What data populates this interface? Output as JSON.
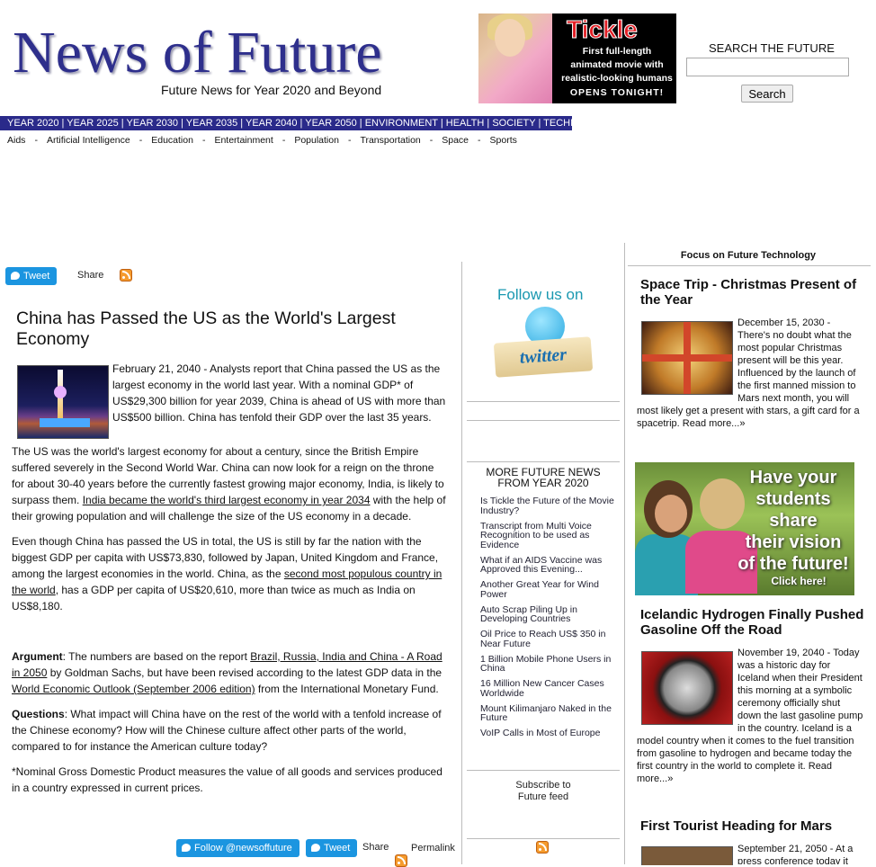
{
  "site": {
    "logo": "News of Future",
    "tagline": "Future News for Year 2020 and Beyond"
  },
  "ad": {
    "title": "Tickle",
    "line1": "First full-length",
    "line2": "animated movie with",
    "line3": "realistic-looking humans",
    "cta": "OPENS TONIGHT!"
  },
  "search": {
    "label": "SEARCH THE FUTURE",
    "value": "",
    "button": "Search"
  },
  "nav": {
    "years": "YEAR 2020 | YEAR 2025  | YEAR 2030 | YEAR 2035  | YEAR 2040 | YEAR 2050  | ENVIRONMENT | HEALTH  | SOCIETY | TECHNOLOGY"
  },
  "subnav": [
    "Aids",
    "Artificial Intelligence",
    "Education",
    "Entertainment",
    "Population",
    "Transportation",
    "Space",
    "Sports"
  ],
  "subnav_sep": "-",
  "social_top": {
    "tweet": "Tweet",
    "share": "Share"
  },
  "article": {
    "headline": "China has Passed the US as the World's Largest Economy",
    "p1": "February 21, 2040 - Analysts report that China passed the US as the largest economy in the world last year. With a nominal GDP* of US$29,300 billion for year 2039, China is ahead of US with more than US$500 billion. China has tenfold their GDP over the last 35 years.",
    "p2a": "The US was the world's largest economy for about a century, since the British Empire suffered severely in the Second World War. China can now look for a reign on the throne for about 30-40 years before the currently fastest growing major economy, India, is likely to surpass them. ",
    "p2link": "India became the world's third largest economy in year 2034",
    "p2b": " with the help of their growing population and will challenge the size of the US economy in a decade.",
    "p3a": "Even though China has passed the US in total, the US is still by far the nation with the biggest GDP per capita with US$73,830, followed by Japan, United Kingdom and France, among the largest economies in the world. China, as the ",
    "p3link": "second most populous country in the world",
    "p3b": ", has a GDP per capita of US$20,610, more than twice as much as India on US$8,180.",
    "arg_label": "Argument",
    "arg_a": ": The numbers are based on the report ",
    "arg_link1": "Brazil, Russia, India and China - A Road in 2050",
    "arg_b": " by Goldman Sachs, but have been revised according to the latest GDP data in the ",
    "arg_link2": "World Economic Outlook (September 2006 edition)",
    "arg_c": " from the International Monetary Fund.",
    "q_label": "Questions",
    "q_text": ": What impact will China have on the rest of the world with a tenfold increase of the Chinese economy? How will the Chinese culture affect other parts of the world, compared to for instance the American culture today?",
    "footnote": "*Nominal Gross Domestic Product measures the value of all goods and services produced in a country expressed in current prices."
  },
  "social_bottom": {
    "follow": "Follow @newsoffuture",
    "tweet": "Tweet",
    "share": "Share",
    "permalink": "Permalink"
  },
  "middle": {
    "follow_us": "Follow us on",
    "twitter_sign": "twitter",
    "more_title": "MORE FUTURE NEWS FROM YEAR 2020",
    "more_items": [
      "Is Tickle the Future of the Movie Industry?",
      "Transcript from Multi Voice Recognition to be used as Evidence",
      "What if an AIDS Vaccine was Approved this Evening...",
      "Another Great Year for Wind Power",
      "Auto Scrap Piling Up in Developing Countries",
      "Oil Price to Reach US$ 350 in Near Future",
      "1 Billion Mobile Phone Users in China",
      "16 Million New Cancer Cases Worldwide",
      "Mount Kilimanjaro Naked in the Future",
      "VoIP Calls in Most of Europe"
    ],
    "subscribe_line1": "Subscribe to",
    "subscribe_line2": "Future feed"
  },
  "right": {
    "focus": "Focus on Future Technology",
    "s1_title": "Space Trip - Christmas Present of the Year",
    "s1_text": "December 15, 2030 - There's no doubt what the most popular Christmas present will be this year. Influenced by the launch of the first manned mission to Mars next month, you will most likely get a present with stars, a gift card for a spacetrip.",
    "read_more": "Read more...»",
    "banner_line1": "Have your",
    "banner_line2": "students",
    "banner_line3": "share",
    "banner_line4": "their vision",
    "banner_line5": "of the future!",
    "banner_click": "Click here!",
    "s2_title": "Icelandic Hydrogen Finally Pushed Gasoline Off the Road",
    "s2_text": "November 19, 2040 - Today was a historic day for Iceland when their President this morning at a symbolic ceremony officially shut down the last gasoline pump in the country. Iceland is a model country when it comes to the fuel transition from gasoline to hydrogen and became today the first country in the world to complete it.",
    "s3_title": "First Tourist Heading for Mars",
    "s3_text": "September 21, 2050 - At a press conference today it"
  }
}
